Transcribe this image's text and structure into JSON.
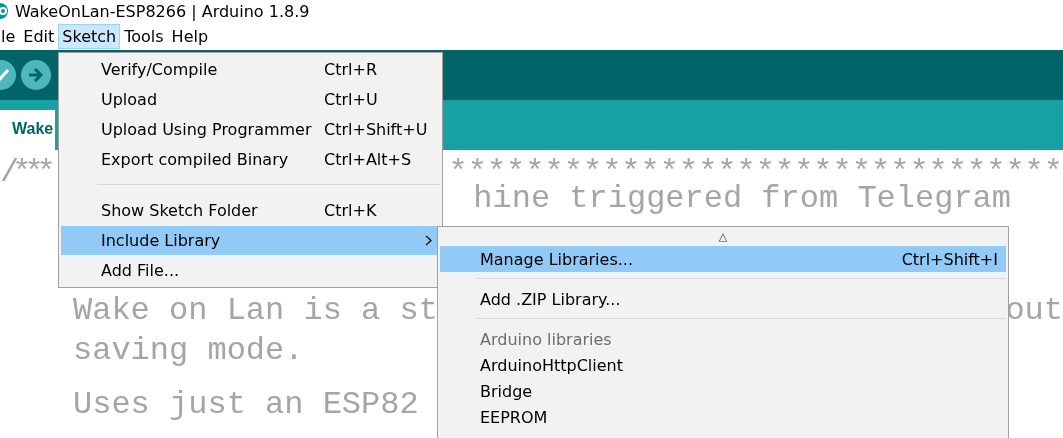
{
  "window": {
    "title": "WakeOnLan-ESP8266 | Arduino 1.8.9"
  },
  "menu_bar": [
    {
      "label": "le",
      "selected": false
    },
    {
      "label": "Edit",
      "selected": false
    },
    {
      "label": "Sketch",
      "selected": true
    },
    {
      "label": "Tools",
      "selected": false
    },
    {
      "label": "Help",
      "selected": false
    }
  ],
  "toolbar": {
    "buttons": [
      {
        "kind": "verify"
      },
      {
        "kind": "upload"
      }
    ]
  },
  "tabs": [
    {
      "label": "Wake",
      "selected": true
    }
  ],
  "editor": {
    "lines": [
      {
        "kind": "rule",
        "pieces": [
          "/***",
          "********************************"
        ]
      },
      {
        "kind": "tail",
        "pieces": [
          "hine triggered from Telegram"
        ]
      },
      {
        "kind": "blank"
      },
      {
        "kind": "split",
        "pieces": [
          "Wake on Lan is a st",
          "out"
        ]
      },
      {
        "kind": "split",
        "pieces": [
          "saving mode."
        ]
      },
      {
        "kind": "blank"
      },
      {
        "kind": "split",
        "pieces": [
          "Uses just an ESP82"
        ]
      }
    ]
  },
  "sketch_menu": {
    "items": [
      {
        "kind": "item",
        "label": "Verify/Compile",
        "shortcut": "Ctrl+R",
        "selected": false
      },
      {
        "kind": "item",
        "label": "Upload",
        "shortcut": "Ctrl+U",
        "selected": false
      },
      {
        "kind": "item",
        "label": "Upload Using Programmer",
        "shortcut": "Ctrl+Shift+U",
        "selected": false
      },
      {
        "kind": "item",
        "label": "Export compiled Binary",
        "shortcut": "Ctrl+Alt+S",
        "selected": false
      },
      {
        "kind": "separator"
      },
      {
        "kind": "item",
        "label": "Show Sketch Folder",
        "shortcut": "Ctrl+K",
        "selected": false
      },
      {
        "kind": "submenu",
        "label": "Include Library",
        "selected": true
      },
      {
        "kind": "item",
        "label": "Add File...",
        "selected": false
      }
    ]
  },
  "library_menu": {
    "scroll_up": "△",
    "items": [
      {
        "kind": "item",
        "label": "Manage Libraries...",
        "shortcut": "Ctrl+Shift+I",
        "selected": true
      },
      {
        "kind": "separator"
      },
      {
        "kind": "item",
        "label": "Add .ZIP Library...",
        "selected": false
      },
      {
        "kind": "separator"
      },
      {
        "kind": "heading",
        "label": "Arduino libraries"
      },
      {
        "kind": "item",
        "label": "ArduinoHttpClient",
        "selected": false
      },
      {
        "kind": "item",
        "label": "Bridge",
        "selected": false
      },
      {
        "kind": "item",
        "label": "EEPROM",
        "selected": false
      }
    ]
  }
}
